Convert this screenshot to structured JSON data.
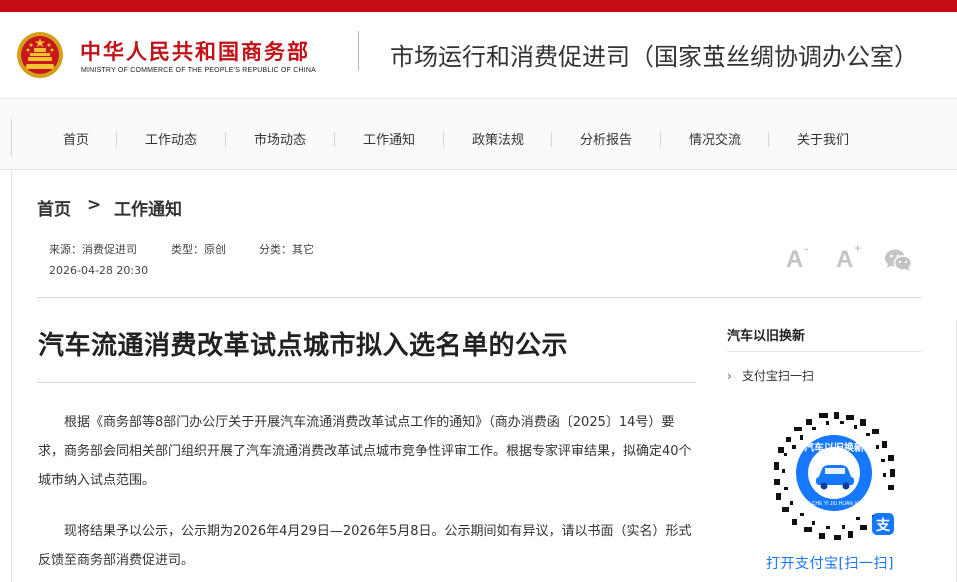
{
  "header": {
    "ministry_cn": "中华人民共和国商务部",
    "ministry_en": "MINISTRY OF COMMERCE OF THE PEOPLE'S REPUBLIC OF CHINA",
    "department": "市场运行和消费促进司（国家茧丝绸协调办公室）"
  },
  "nav": {
    "items": [
      "首页",
      "工作动态",
      "市场动态",
      "工作通知",
      "政策法规",
      "分析报告",
      "情况交流",
      "关于我们"
    ]
  },
  "breadcrumb": {
    "home": "首页",
    "separator": ">",
    "current": "工作通知"
  },
  "meta": {
    "source": "来源：消费促进司",
    "type": "类型：原创",
    "category": "分类：其它",
    "datetime": "2026-04-28 20:30"
  },
  "tools": {
    "font_decrease": "A",
    "font_decrease_mark": "-",
    "font_increase": "A",
    "font_increase_mark": "+",
    "wechat_icon": "wechat-icon"
  },
  "article": {
    "title": "汽车流通消费改革试点城市拟入选名单的公示",
    "paragraphs": [
      "根据《商务部等8部门办公厅关于开展汽车流通消费改革试点工作的通知》（商办消费函〔2025〕14号）要求，商务部会同相关部门组织开展了汽车流通消费改革试点城市竞争性评审工作。根据专家评审结果，拟确定40个城市纳入试点范围。",
      "现将结果予以公示，公示期为2026年4月29日—2026年5月8日。公示期间如有异议，请以书面（实名）形式反馈至商务部消费促进司。"
    ]
  },
  "sidebar": {
    "title": "汽车以旧换新",
    "link": "支付宝扫一扫",
    "link_chevron": "›",
    "qr_caption": "打开支付宝[扫一扫]",
    "qr_ring_text": "汽车以旧换新",
    "qr_ring_pinyin": "QI CHE YI JIU HUAN XIN",
    "qr_badge": "支"
  },
  "colors": {
    "brand_red": "#c60c12",
    "alipay_blue": "#1677ff"
  }
}
